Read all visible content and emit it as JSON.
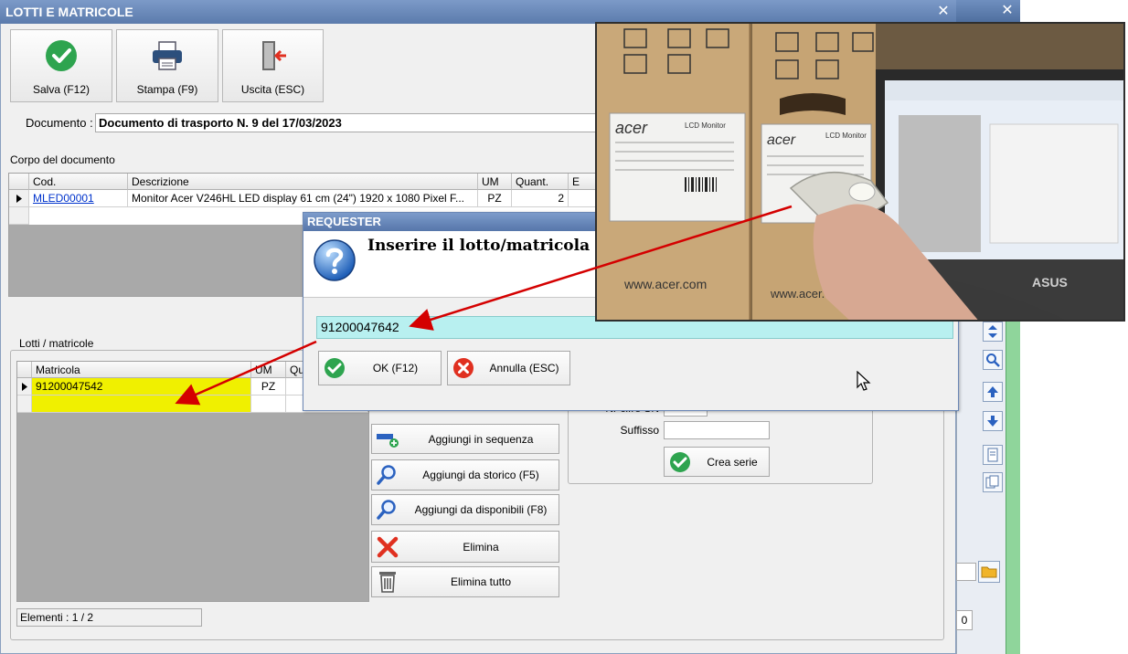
{
  "window": {
    "title": "LOTTI E MATRICOLE",
    "close_glyph": "✕"
  },
  "toolbar": {
    "save_label": "Salva (F12)",
    "print_label": "Stampa (F9)",
    "exit_label": "Uscita (ESC)"
  },
  "document": {
    "label": "Documento :",
    "value": "Documento di trasporto N. 9 del 17/03/2023"
  },
  "body_section": {
    "label": "Corpo del documento",
    "columns": [
      "Cod.",
      "Descrizione",
      "UM",
      "Quant.",
      "E"
    ],
    "row": {
      "code": "MLED00001",
      "description": "Monitor Acer V246HL LED display 61 cm (24\") 1920 x 1080 Pixel F...",
      "um": "PZ",
      "qty": "2"
    }
  },
  "lots_section": {
    "label": "Lotti / matricole",
    "columns": [
      "Matricola",
      "UM",
      "Qu"
    ],
    "row": {
      "serial": "91200047542",
      "um": "PZ"
    },
    "count_text": "Elementi : 1 / 2"
  },
  "actions": {
    "add_sequence": "Aggiungi in sequenza",
    "add_history": "Aggiungi da storico (F5)",
    "add_available": "Aggiungi da disponibili (F8)",
    "delete": "Elimina",
    "delete_all": "Elimina tutto"
  },
  "series_panel": {
    "nr_label": "Nr cifre SN",
    "suffix_label": "Suffisso",
    "create_label": "Crea serie"
  },
  "right_field_value": "0",
  "requester": {
    "title": "REQUESTER",
    "prompt": "Inserire il lotto/matricola",
    "input_value": "91200047642",
    "ok_label": "OK (F12)",
    "cancel_label": "Annulla (ESC)"
  },
  "photo": {
    "box_brand": "acer",
    "box_label": "LCD Monitor",
    "box_url": "www.acer.com",
    "laptop_brand": "ASUS"
  },
  "colors": {
    "title_bar": "#5b7bac",
    "selected_row": "#f0f000",
    "input_bg": "#b8f0f0",
    "arrow": "#d40000",
    "accent_green": "#2ea44f"
  }
}
